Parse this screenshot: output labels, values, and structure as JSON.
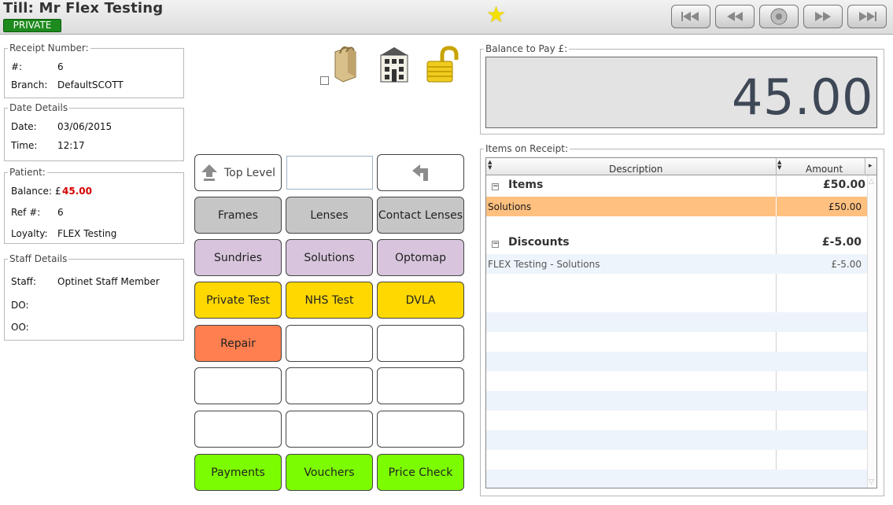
{
  "header": {
    "title": "Till: Mr Flex Testing",
    "badge": "PRIVATE",
    "nav": [
      "first-icon",
      "previous-icon",
      "stop-icon",
      "next-icon",
      "last-icon"
    ]
  },
  "receipt": {
    "legend": "Receipt Number:",
    "number_label": "#:",
    "number_value": "6",
    "branch_label": "Branch:",
    "branch_value": "DefaultSCOTT"
  },
  "date": {
    "legend": "Date Details",
    "date_label": "Date:",
    "date_value": "03/06/2015",
    "time_label": "Time:",
    "time_value": "12:17"
  },
  "patient": {
    "legend": "Patient:",
    "balance_label": "Balance:",
    "currency": "£",
    "balance_value": "45.00",
    "ref_label": "Ref #:",
    "ref_value": "6",
    "loyalty_label": "Loyalty:",
    "loyalty_value": "FLEX Testing"
  },
  "staff": {
    "legend": "Staff Details",
    "staff_label": "Staff:",
    "staff_value": "Optinet Staff Member",
    "do_label": "DO:",
    "oo_label": "OO:"
  },
  "buttons": {
    "top_level": "Top Level",
    "frames": "Frames",
    "lenses": "Lenses",
    "contact_lenses": "Contact Lenses",
    "sundries": "Sundries",
    "solutions": "Solutions",
    "optomap": "Optomap",
    "private_test": "Private Test",
    "nhs_test": "NHS Test",
    "dvla": "DVLA",
    "repair": "Repair",
    "payments": "Payments",
    "vouchers": "Vouchers",
    "price_check": "Price Check"
  },
  "balance_to_pay": {
    "legend": "Balance to Pay £:",
    "value": "45.00"
  },
  "items_on_receipt": {
    "legend": "Items on Receipt:",
    "col_description": "Description",
    "col_amount": "Amount",
    "groups": [
      {
        "name": "Items",
        "total": "£50.00",
        "rows": [
          {
            "description": "Solutions",
            "amount": "£50.00"
          }
        ]
      },
      {
        "name": "Discounts",
        "total": "£-5.00",
        "rows": [
          {
            "description": "FLEX Testing - Solutions",
            "amount": "£-5.00"
          }
        ]
      }
    ]
  },
  "colors": {
    "grey": "#c6c6c6",
    "lilac": "#d8c5dd",
    "yellow": "#ffd800",
    "orange": "#ff7f50",
    "green": "#7cfc00",
    "selected_row": "#ffc080"
  }
}
